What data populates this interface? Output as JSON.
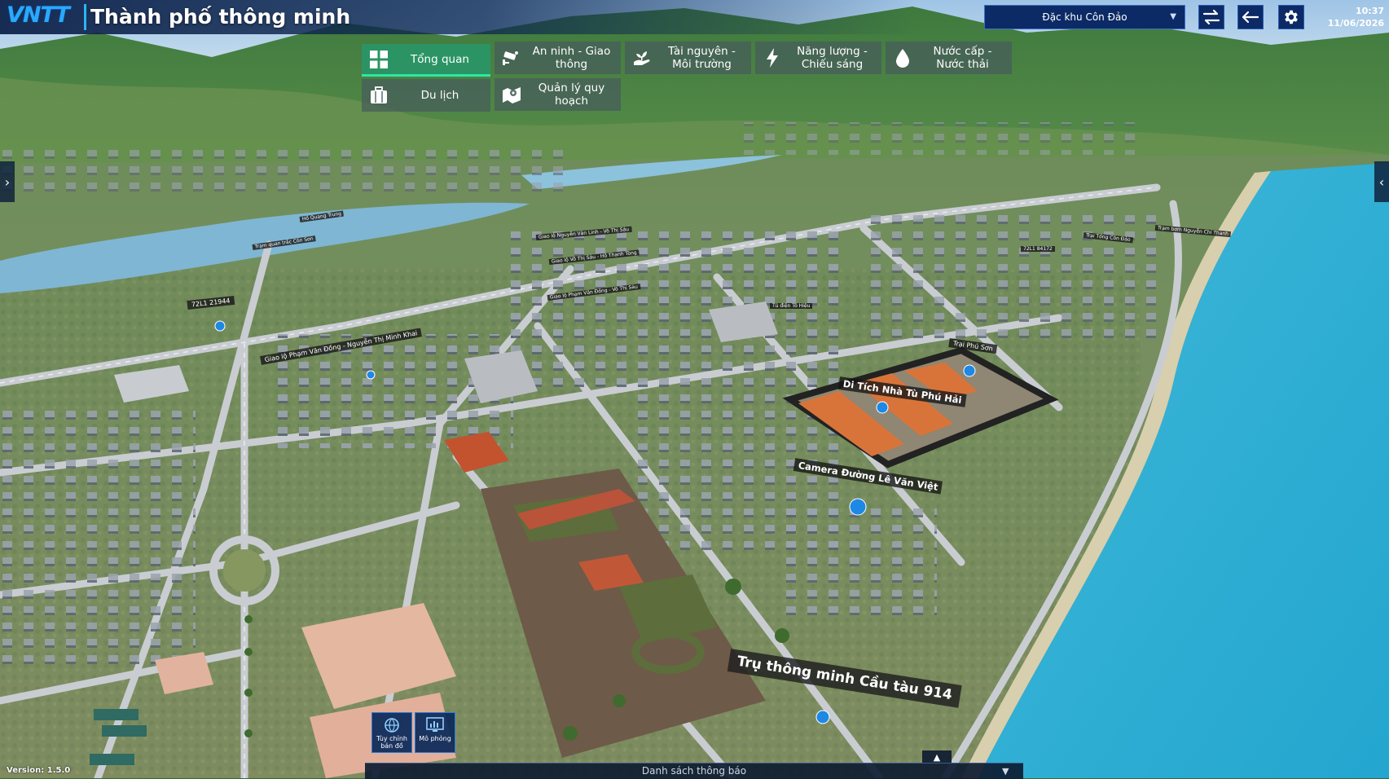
{
  "header": {
    "logo_text": "VNTT",
    "logo_sub": "",
    "title": "Thành phố thông minh",
    "region_select": {
      "value": "Đặc khu Côn Đảo"
    },
    "clock": {
      "time": "10:37",
      "date": "11/06/2026"
    },
    "icons": {
      "swap": "swap-arrows-icon",
      "back": "back-arrow-icon",
      "settings": "gear-icon"
    }
  },
  "menu": {
    "items": [
      {
        "label": "Tổng quan",
        "icon": "grid-icon",
        "active": true
      },
      {
        "label": "An ninh - Giao thông",
        "icon": "cctv-camera-icon"
      },
      {
        "label": "Tài nguyên - Môi trường",
        "icon": "hand-plant-icon"
      },
      {
        "label": "Năng lượng - Chiếu sáng",
        "icon": "lightning-icon"
      },
      {
        "label": "Nước cấp - Nước thải",
        "icon": "water-drop-icon"
      },
      {
        "label": "Du lịch",
        "icon": "luggage-icon"
      },
      {
        "label": "Quản lý quy hoạch",
        "icon": "map-pin-icon"
      }
    ]
  },
  "map_labels": {
    "pole_914": "Trụ thông minh Cầu tàu 914",
    "camera_le_van_viet": "Camera Đường Lê Văn Việt",
    "di_tich": "Di Tích Nhà Tù Phú Hải",
    "trai_phu_son": "Trại Phú Sơn",
    "giao_lo_pvd_ntmk": "Giao lộ Phạm Văn Đồng - Nguyễn Thị Minh Khai",
    "giao_lo_pvd_vts": "Giao lộ Phạm Văn Đồng - Võ Thị Sáu",
    "giao_lo_vts_nvt": "Giao lộ Võ Thị Sáu - Hồ Thanh Tòng",
    "giao_lo_nvl_vts": "Giao lộ Nguyễn Văn Linh - Võ Thị Sáu",
    "plate_1": "72L1 21944",
    "plate_2": "72L1 84172",
    "to_dien": "Tủ điện Tô Hiệu",
    "trai_tong": "Trại Tổng Côn Đảo",
    "nguyen_chi_thanh": "Trạm bơm Nguyễn Chí Thanh",
    "ho_quang_trung": "Hồ Quang Trung",
    "tram_quan_trac": "Trạm quan trắc Côn Sơn"
  },
  "bottom": {
    "tool_customize": "Tùy chỉnh bản đồ",
    "tool_simulate": "Mô phỏng",
    "notification_title": "Danh sách thông báo",
    "version": "Version: 1.5.0"
  },
  "colors": {
    "header_bg": "#0c2650",
    "accent_blue": "#29b6f6",
    "active_menu": "#289669",
    "sea": "#2fb2d6",
    "roof_orange": "#d8743a"
  }
}
